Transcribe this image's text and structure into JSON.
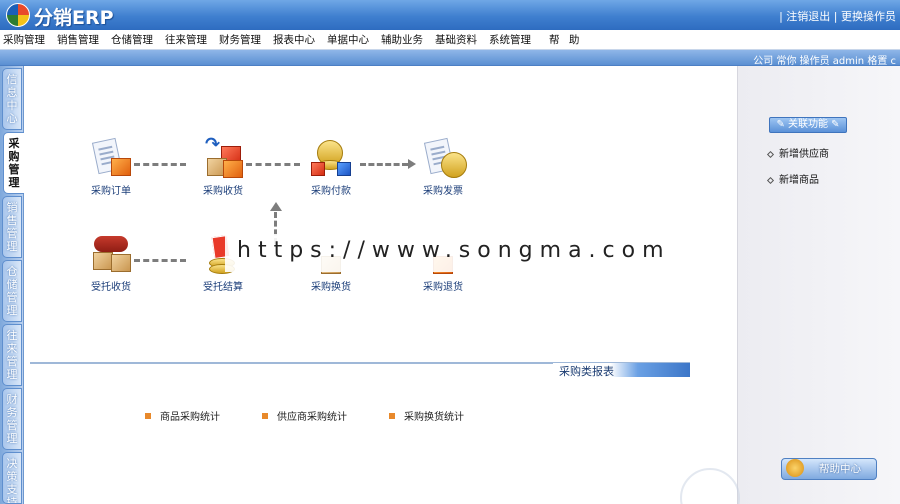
{
  "header": {
    "app_title": "分销ERP",
    "logout_link": "注销退出",
    "switch_operator_link": "更换操作员"
  },
  "menu": [
    "采购管理",
    "销售管理",
    "仓储管理",
    "往来管理",
    "财务管理",
    "报表中心",
    "单据中心",
    "辅助业务",
    "基础资料",
    "系统管理",
    "帮 助"
  ],
  "status": {
    "info": "公司 常你   操作员 admin   格置 c"
  },
  "left_tabs": [
    {
      "label": "信息中心",
      "active": false
    },
    {
      "label": "采购管理",
      "active": true
    },
    {
      "label": "销售管理",
      "active": false
    },
    {
      "label": "仓储管理",
      "active": false
    },
    {
      "label": "往来管理",
      "active": false
    },
    {
      "label": "财务管理",
      "active": false
    },
    {
      "label": "决策支持",
      "active": false
    }
  ],
  "flow": {
    "purchase_order": "采购订单",
    "purchase_receipt": "采购收货",
    "purchase_payment": "采购付款",
    "purchase_invoice": "采购发票",
    "consign_receipt": "受托收货",
    "consign_settle": "受托结算",
    "purchase_exchange": "采购换货",
    "purchase_return": "采购退货"
  },
  "reports": {
    "title": "采购类报表",
    "items": [
      "商品采购统计",
      "供应商采购统计",
      "采购换货统计"
    ]
  },
  "quick": {
    "button": "关联功能",
    "links": [
      "新增供应商",
      "新增商品"
    ]
  },
  "help": {
    "button": "帮助中心"
  },
  "watermark": "https://www.songma.com"
}
